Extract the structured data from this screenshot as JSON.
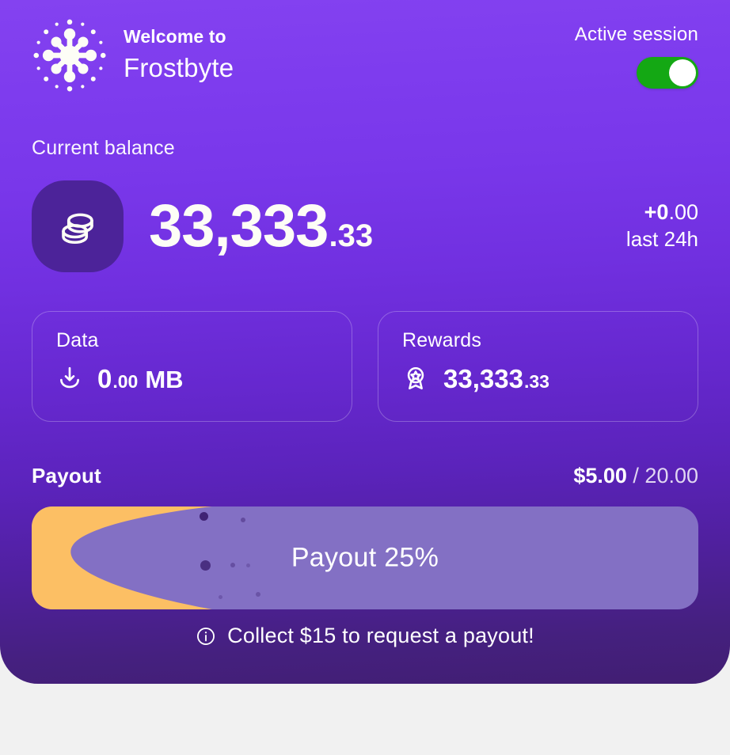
{
  "header": {
    "welcome_prefix": "Welcome to",
    "brand_name": "Frostbyte",
    "logo_icon": "snowflake-burst-icon",
    "session_label": "Active session",
    "session_toggle_state": "on"
  },
  "balance": {
    "label": "Current balance",
    "icon": "stacked-coins-icon",
    "integer_part": "33,333",
    "decimal_part": ".33",
    "delta_value": "+0",
    "delta_decimal": ".00",
    "delta_period": "last 24h"
  },
  "stats": [
    {
      "title": "Data",
      "icon": "download-icon",
      "integer_part": "0",
      "decimal_part": ".00",
      "unit": "MB"
    },
    {
      "title": "Rewards",
      "icon": "award-medal-icon",
      "integer_part": "33,333",
      "decimal_part": ".33",
      "unit": ""
    }
  ],
  "payout": {
    "title": "Payout",
    "current": "$5.00",
    "separator_and_total": " / 20.00",
    "progress_label": "Payout 25%",
    "progress_percent": 25,
    "note_icon": "info-circle-icon",
    "note_text": "Collect $15 to request a payout!"
  },
  "colors": {
    "gradient_top": "#8442f0",
    "gradient_bottom": "#411e72",
    "page_background": "#f1f1f1",
    "toggle_on": "#14a814",
    "progress_fill": "#fcbf64",
    "progress_track": "#8370c4",
    "coin_badge": "#4c2399",
    "bubble": "#3c1f70"
  }
}
